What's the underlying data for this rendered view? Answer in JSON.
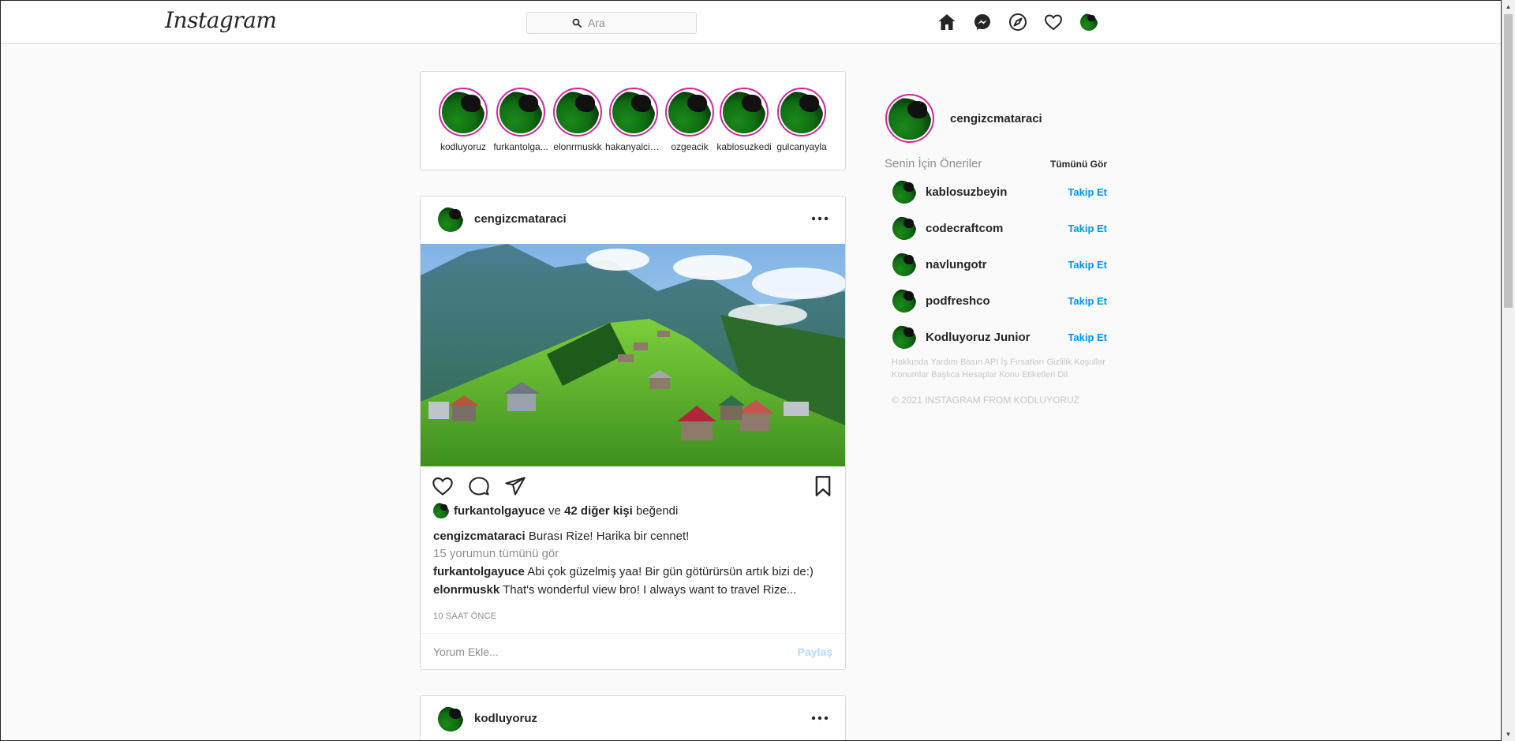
{
  "header": {
    "logo": "Instagram",
    "search_placeholder": "Ara"
  },
  "stories": [
    {
      "name": "kodluyoruz"
    },
    {
      "name": "furkantolga..."
    },
    {
      "name": "elonrmuskk"
    },
    {
      "name": "hakanyalcin..."
    },
    {
      "name": "ozgeacik"
    },
    {
      "name": "kablosuzkedi"
    },
    {
      "name": "gulcanyayla"
    }
  ],
  "post": {
    "username": "cengizcmataraci",
    "likes": {
      "user": "furkantolgayuce",
      "connector": "ve",
      "others": "42 diğer kişi",
      "suffix": "beğendi"
    },
    "caption": {
      "user": "cengizcmataraci",
      "text": "Burası Rize! Harika bir cennet!"
    },
    "view_all": "15 yorumun tümünü gör",
    "comments": [
      {
        "user": "furkantolgayuce",
        "text": "Abi çok güzelmiş yaa! Bir gün götürürsün artık bizi de:)"
      },
      {
        "user": "elonrmuskk",
        "text": "That's wonderful view bro! I always want to travel Rize..."
      }
    ],
    "time_ago": "10 SAAT ÖNCE",
    "comment_placeholder": "Yorum Ekle...",
    "share_label": "Paylaş"
  },
  "post2": {
    "username": "kodluyoruz"
  },
  "sidebar": {
    "username": "cengizcmataraci",
    "suggestions_title": "Senin İçin Öneriler",
    "see_all": "Tümünü Gör",
    "follow_label": "Takip Et",
    "suggestions": [
      {
        "name": "kablosuzbeyin"
      },
      {
        "name": "codecraftcom"
      },
      {
        "name": "navlungotr"
      },
      {
        "name": "podfreshco"
      },
      {
        "name": "Kodluyoruz Junior"
      }
    ],
    "footer_links": "Hakkında Yardım Basın API İş Fırsatları Gizlilik Koşullar Konumlar Başlıca Hesaplar Konu Etiketleri Dil",
    "copyright": "© 2021 INSTAGRAM FROM KODLUYORUZ"
  },
  "colors": {
    "accent": "#0095f6",
    "story_ring": "#d6249f",
    "border": "#dbdbdb",
    "background": "#fafafa"
  }
}
